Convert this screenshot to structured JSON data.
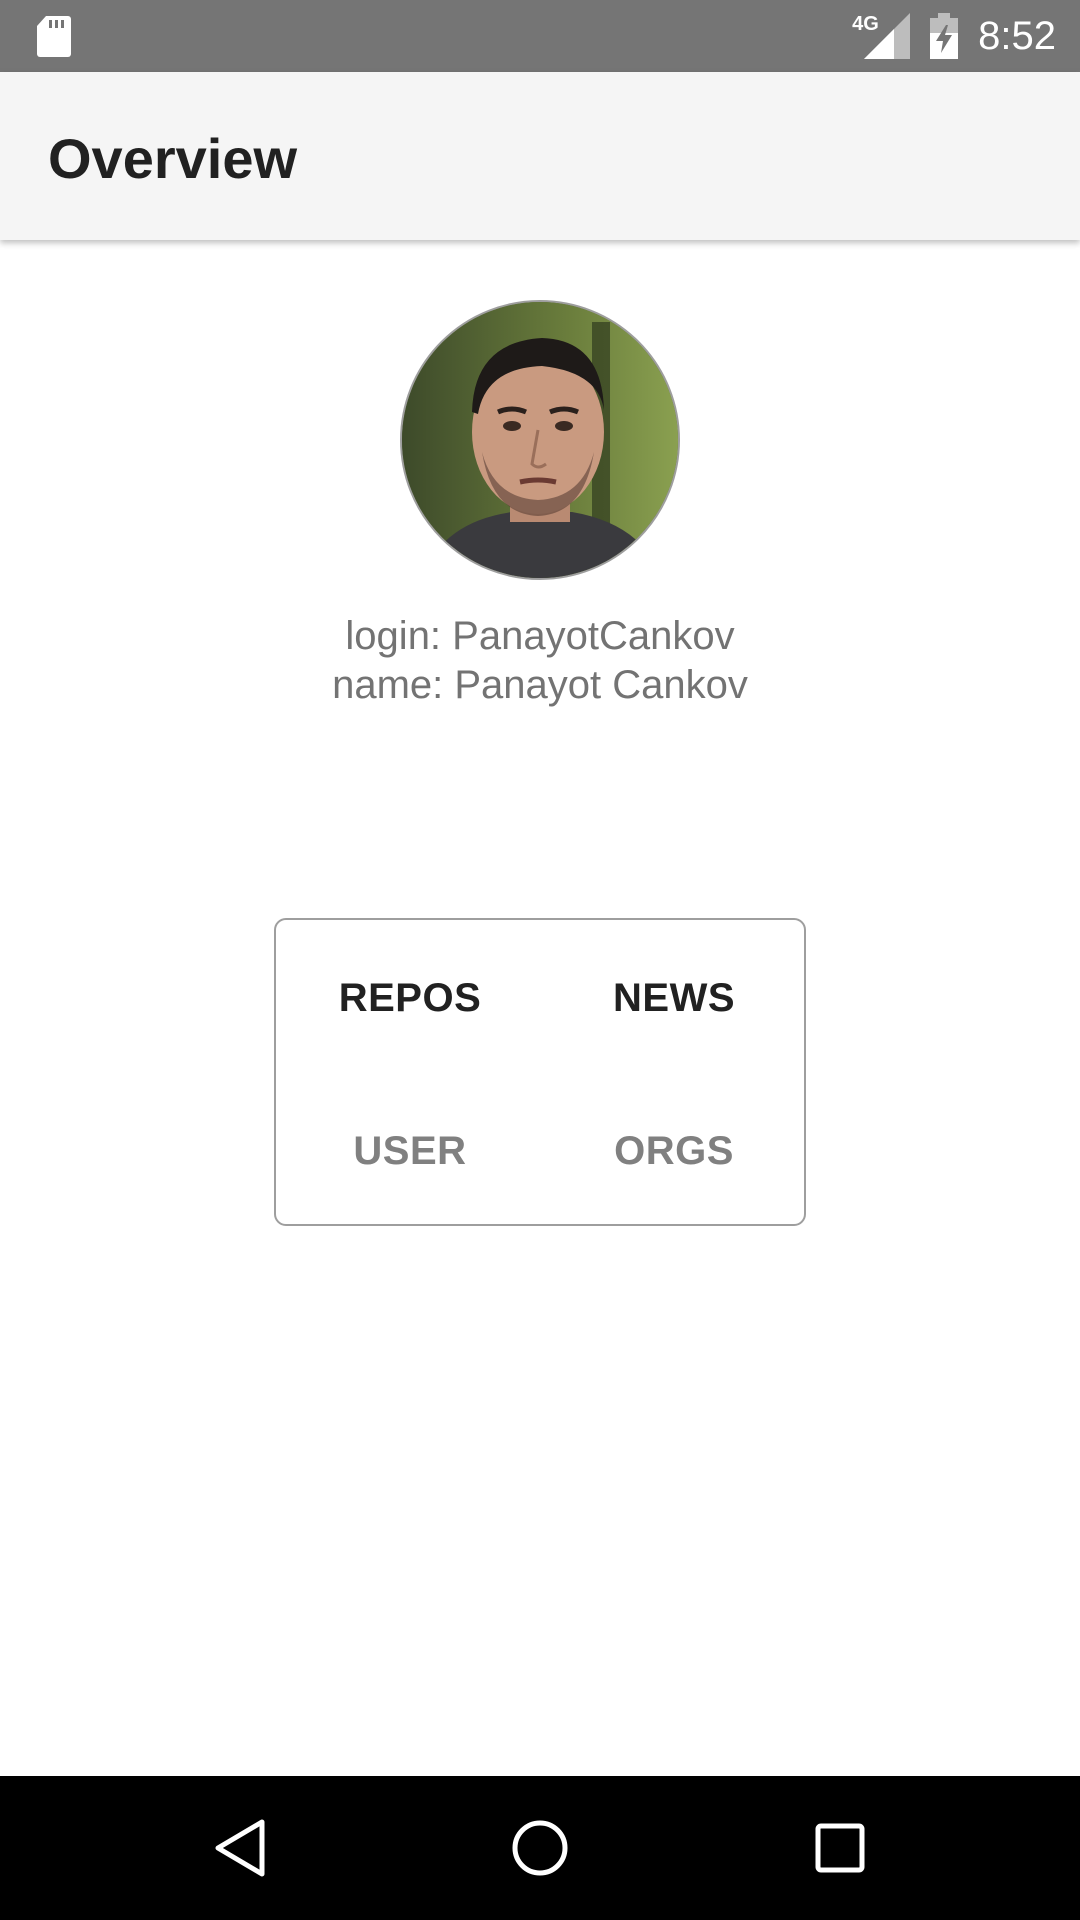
{
  "status_bar": {
    "network_type": "4G",
    "time": "8:52",
    "icons": [
      "sd-card-icon",
      "signal-icon",
      "battery-charging-icon"
    ]
  },
  "app_bar": {
    "title": "Overview"
  },
  "profile": {
    "avatar_icon": "user-avatar-photo",
    "login_line": "login: PanayotCankov",
    "name_line": "name: Panayot Cankov"
  },
  "menu": {
    "repos": "REPOS",
    "news": "NEWS",
    "user": "USER",
    "orgs": "ORGS"
  },
  "nav_bar": {
    "icons": [
      "back-icon",
      "home-icon",
      "recents-icon"
    ]
  },
  "colors": {
    "status_bar": "#757575",
    "app_bar": "#f5f5f5",
    "active_text": "#212121",
    "inactive_text": "#808080",
    "info_text": "#737373",
    "nav_bar": "#000000"
  }
}
